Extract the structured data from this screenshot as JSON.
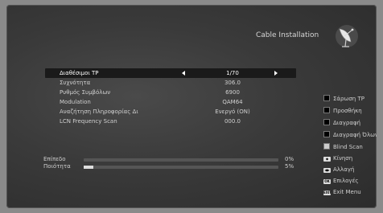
{
  "header": {
    "title": "Cable Installation",
    "icon": "satellite-dish-icon"
  },
  "menu": {
    "rows": [
      {
        "label": "Διαθέσιμοι TP",
        "value": "1/70"
      },
      {
        "label": "Συχνότητα",
        "value": "306.0"
      },
      {
        "label": "Ρυθμός Συμβόλων",
        "value": "6900"
      },
      {
        "label": "Modulation",
        "value": "QAM64"
      },
      {
        "label": "Αναζήτηση Πληροφορίας Δι",
        "value": "Ενεργό (ON)"
      },
      {
        "label": "LCN Frequency Scan",
        "value": "000.0"
      }
    ]
  },
  "signal": {
    "level": {
      "label": "Επίπεδο",
      "percent": "0%",
      "fraction": 0
    },
    "quality": {
      "label": "Ποιότητα",
      "percent": "5%",
      "fraction": 0.05
    }
  },
  "sidebar": {
    "items": [
      {
        "label": "Σάρωση TP",
        "color": "#000000"
      },
      {
        "label": "Προσθήκη",
        "color": "#000000"
      },
      {
        "label": "Διαγραφή",
        "color": "#000000"
      },
      {
        "label": "Διαγραφή Όλων",
        "color": "#000000"
      },
      {
        "label": "Blind Scan",
        "color": "#cccccc"
      }
    ],
    "keys": [
      {
        "key": "◆",
        "label": "Κίνηση"
      },
      {
        "key": "◀▶",
        "label": "Αλλαγή"
      },
      {
        "key": "OK",
        "label": "Επιλογές"
      },
      {
        "key": "EXIT",
        "label": "Exit Menu"
      }
    ]
  }
}
